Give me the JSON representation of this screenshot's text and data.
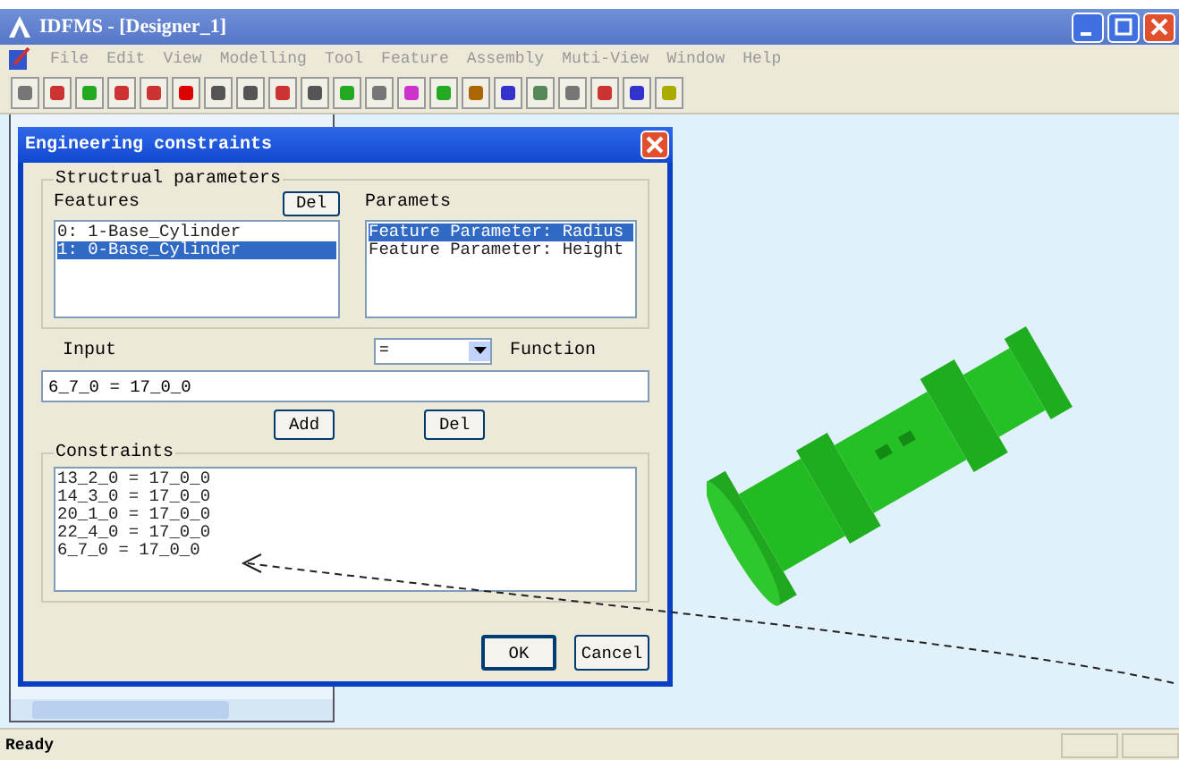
{
  "window": {
    "title": "IDFMS - [Designer_1]"
  },
  "menu": [
    "File",
    "Edit",
    "View",
    "Modelling",
    "Tool",
    "Feature",
    "Assembly",
    "Muti-View",
    "Window",
    "Help"
  ],
  "dialog": {
    "title": "Engineering constraints",
    "structural": {
      "label": "Structrual parameters",
      "features": {
        "label": "Features",
        "delete": "Del",
        "items": [
          {
            "text": "0: 1-Base_Cylinder",
            "selected": false
          },
          {
            "text": "1: 0-Base_Cylinder",
            "selected": true
          }
        ]
      },
      "parameters": {
        "label": "Paramets",
        "items": [
          {
            "text": "Feature Parameter: Radius",
            "selected": true
          },
          {
            "text": "Feature Parameter: Height",
            "selected": false
          }
        ]
      }
    },
    "input": {
      "label": "Input",
      "value": "6_7_0 = 17_0_0"
    },
    "operator": {
      "value": "="
    },
    "function_label": "Function",
    "add": "Add",
    "delete": "Del",
    "constraints": {
      "label": "Constraints",
      "items": [
        "13_2_0 = 17_0_0",
        "14_3_0 = 17_0_0",
        "20_1_0 = 17_0_0",
        "22_4_0 = 17_0_0",
        "6_7_0 = 17_0_0"
      ]
    },
    "buttons": [
      "OK",
      "Cancel"
    ]
  },
  "status_bar": {
    "text": "Ready"
  }
}
